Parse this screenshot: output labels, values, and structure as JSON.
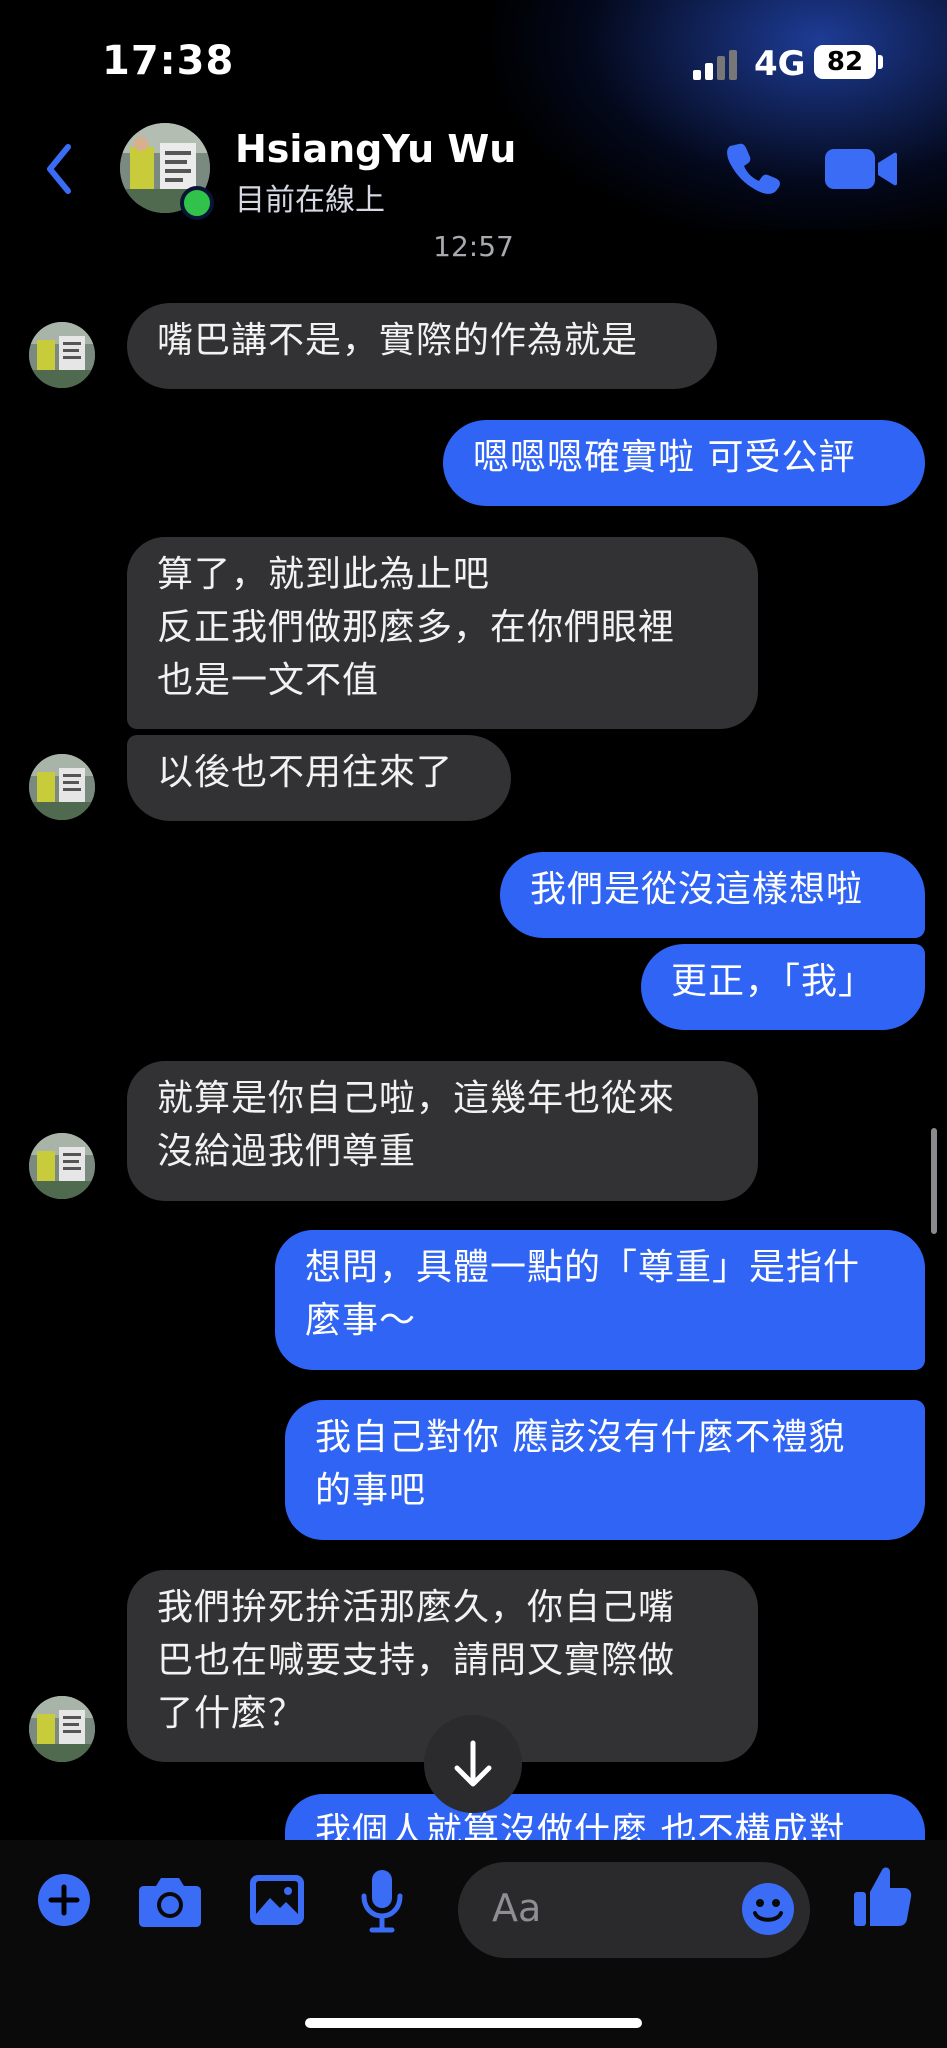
{
  "status_bar": {
    "time": "17:38",
    "network": "4G",
    "battery": "82"
  },
  "header": {
    "contact_name": "HsiangYu Wu",
    "contact_status": "目前在線上",
    "icons": [
      "back-chevron-icon",
      "phone-icon",
      "video-camera-icon"
    ]
  },
  "chat": {
    "timestamp": "12:57",
    "messages": [
      {
        "side": "in",
        "text": "嘴巴講不是，實際的作為就是"
      },
      {
        "side": "out",
        "text": "嗯嗯嗯確實啦 可受公評"
      },
      {
        "side": "in",
        "text": "算了，就到此為止吧\n反正我們做那麼多，在你們眼裡\n也是一文不值"
      },
      {
        "side": "in",
        "text": "以後也不用往來了"
      },
      {
        "side": "out",
        "text": "我們是從沒這樣想啦"
      },
      {
        "side": "out",
        "text": "更正，「我」"
      },
      {
        "side": "in",
        "text": "就算是你自己啦，這幾年也從來\n沒給過我們尊重"
      },
      {
        "side": "out",
        "text": "想問，具體一點的「尊重」是指什\n麼事～"
      },
      {
        "side": "out",
        "text": "我自己對你 應該沒有什麼不禮貌\n的事吧"
      },
      {
        "side": "in",
        "text": "我們拚死拚活那麼久，你自己嘴\n巴也在喊要支持，請問又實際做\n了什麼？"
      },
      {
        "side": "out",
        "text": "我個人就算沒做什麼 也不構成對"
      }
    ]
  },
  "composer": {
    "placeholder": "Aa",
    "icons": [
      "plus-icon",
      "camera-icon",
      "gallery-icon",
      "microphone-icon",
      "emoji-icon",
      "thumbs-up-icon"
    ]
  },
  "colors": {
    "outgoing_bubble": "#2f64f5",
    "incoming_bubble": "#323234",
    "accent": "#3b6cf6",
    "online": "#31c24c"
  }
}
